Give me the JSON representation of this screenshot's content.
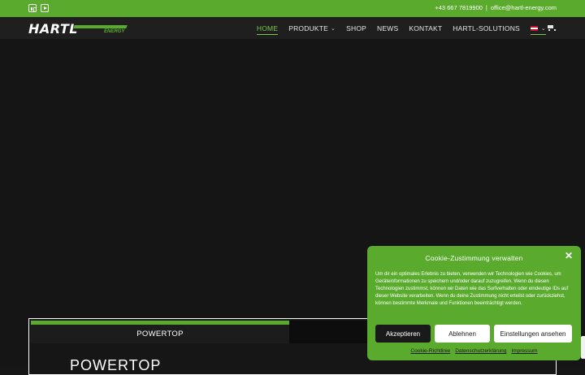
{
  "topbar": {
    "phone": "+43 667 7819900",
    "separator": "|",
    "email": "office@hartl-energy.com",
    "social": [
      "linkedin-icon",
      "youtube-icon"
    ],
    "color": "#5aab2d"
  },
  "logo": {
    "main": "HARTL",
    "sub": "ENERGY"
  },
  "nav": {
    "items": [
      {
        "label": "HOME",
        "active": true
      },
      {
        "label": "PRODUKTE",
        "dropdown": true
      },
      {
        "label": "SHOP"
      },
      {
        "label": "NEWS"
      },
      {
        "label": "KONTAKT"
      },
      {
        "label": "HARTL-SOLUTIONS"
      }
    ],
    "language": "AT",
    "cart_icon": "cart-icon"
  },
  "tabs": {
    "active_label": "POWERTOP",
    "title": "POWERTOP"
  },
  "cookie": {
    "heading": "Cookie-Zustimmung verwalten",
    "text": "Um dir ein optimales Erlebnis zu bieten, verwenden wir Technologien wie Cookies, um Geräteinformationen zu speichern und/oder darauf zuzugreifen. Wenn du diesen Technologien zustimmst, können wir Daten wie das Surfverhalten oder eindeutige IDs auf dieser Website verarbeiten. Wenn du deine Zustimmung nicht erteilst oder zurückziehst, können bestimmte Merkmale und Funktionen beeinträchtigt werden.",
    "accept": "Akzeptieren",
    "deny": "Ablehnen",
    "settings": "Einstellungen ansehen",
    "links": [
      "Cookie-Richtlinie",
      "Datenschutzerklärung",
      "Impressum"
    ],
    "close_icon": "close-icon"
  }
}
